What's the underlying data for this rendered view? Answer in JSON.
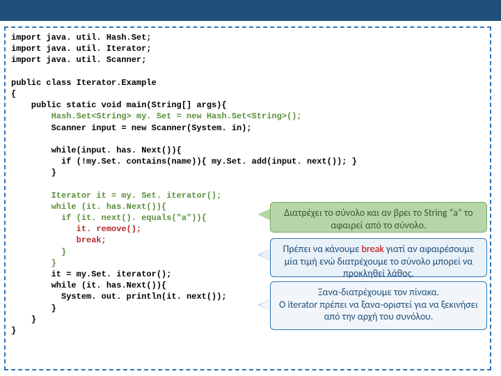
{
  "code": {
    "l1": "import java. util. Hash.Set;",
    "l2": "import java. util. Iterator;",
    "l3": "import java. util. Scanner;",
    "l4": "",
    "l5": "public class Iterator.Example",
    "l6": "{",
    "l7": "    public static void main(String[] args){",
    "l8a": "        ",
    "l8b": "Hash.Set<String> my. Set = new Hash.Set<String>();",
    "l9": "        Scanner input = new Scanner(System. in);",
    "l10": "",
    "l11": "        while(input. has. Next()){",
    "l12": "          if (!my.Set. contains(name)){ my.Set. add(input. next()); }",
    "l13": "        }",
    "l14": "",
    "l15a": "        ",
    "l15b": "Iterator it = my. Set. iterator();",
    "l16a": "        ",
    "l16b": "while (it. has.Next()){",
    "l17a": "          ",
    "l17b": "if (it. next(). equals(\"a\")){",
    "l18a": "             ",
    "l18b": "it. remove();",
    "l19a": "             ",
    "l19b": "break;",
    "l20a": "          ",
    "l20b": "}",
    "l21a": "        ",
    "l21b": "}",
    "l22": "        it = my.Set. iterator();",
    "l23": "        while (it. has.Next()){",
    "l24": "          System. out. println(it. next());",
    "l25": "        }",
    "l26": "    }",
    "l27": "}"
  },
  "callouts": {
    "c1": "Διατρέχει το σύνολο και αν βρει το String “a” το αφαιρεί από το σύνολο.",
    "c2_pre": "Πρέπει να κάνουμε ",
    "c2_break": "break",
    "c2_post": " γιατί αν αφαιρέσουμε μία τιμή ενώ διατρέχουμε το σύνολο μπορεί να προκληθεί λάθος.",
    "c3": "Ξανα-διατρέχουμε τον πίνακα.\nO iterator πρέπει να ξανα-οριστεί για να ξεκινήσει από την αρχή του συνόλου."
  }
}
